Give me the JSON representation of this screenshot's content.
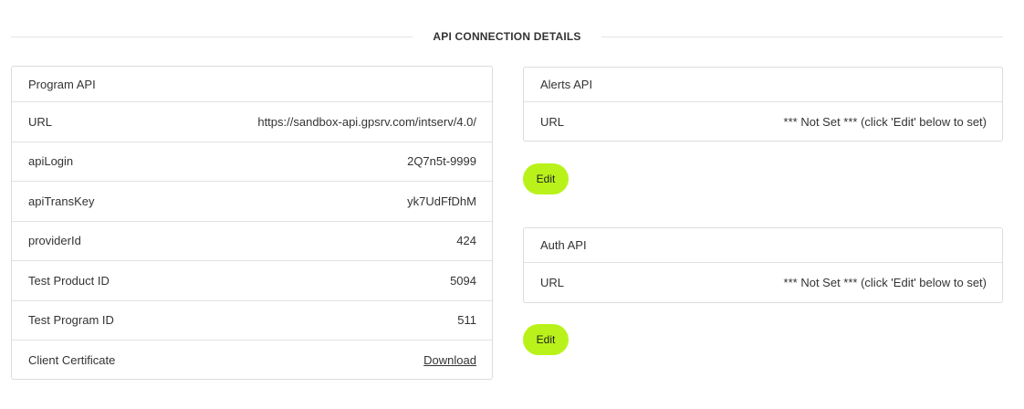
{
  "section_title": "API CONNECTION DETAILS",
  "program_api": {
    "title": "Program API",
    "rows": [
      {
        "label": "URL",
        "value": "https://sandbox-api.gpsrv.com/intserv/4.0/"
      },
      {
        "label": "apiLogin",
        "value": "2Q7n5t-9999"
      },
      {
        "label": "apiTransKey",
        "value": "yk7UdFfDhM"
      },
      {
        "label": "providerId",
        "value": "424"
      },
      {
        "label": "Test Product ID",
        "value": "5094"
      },
      {
        "label": "Test Program ID",
        "value": "511"
      },
      {
        "label": "Client Certificate",
        "value": "Download"
      }
    ]
  },
  "alerts_api": {
    "title": "Alerts API",
    "url_label": "URL",
    "url_value": "*** Not Set *** (click 'Edit' below to set)",
    "edit_label": "Edit"
  },
  "auth_api": {
    "title": "Auth API",
    "url_label": "URL",
    "url_value": "*** Not Set *** (click 'Edit' below to set)",
    "edit_label": "Edit"
  },
  "colors": {
    "accent_button": "#b9f21a",
    "border": "#dcdcdc",
    "text": "#333333"
  }
}
